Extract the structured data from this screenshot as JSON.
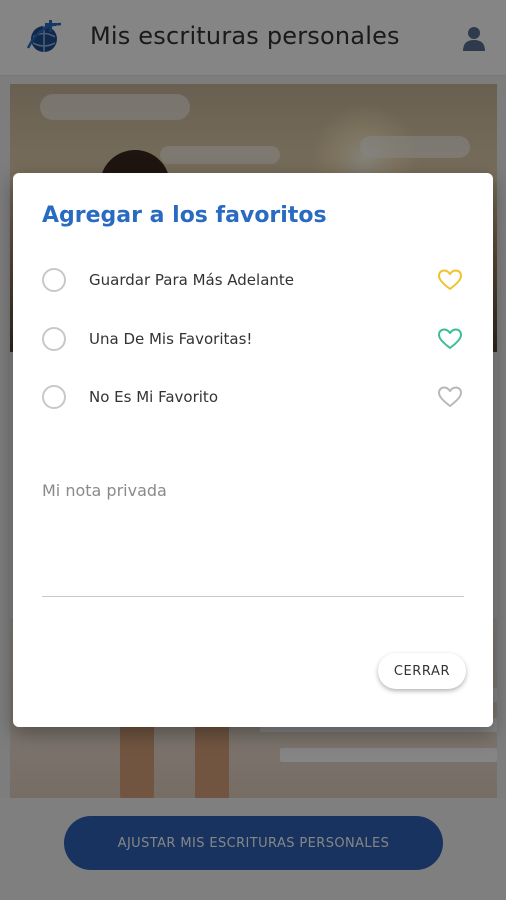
{
  "header": {
    "title": "Mis escrituras personales",
    "logo_icon": "globe-cross-icon",
    "user_icon": "user-icon"
  },
  "footer": {
    "adjust_button_label": "AJUSTAR MIS ESCRITURAS PERSONALES"
  },
  "dialog": {
    "title": "Agregar a los favoritos",
    "options": [
      {
        "label": "Guardar Para Más Adelante",
        "icon": "heart-icon",
        "color": "#f2c12e",
        "selected": false
      },
      {
        "label": "Una De Mis Favoritas!",
        "icon": "heart-icon",
        "color": "#3cbf8f",
        "selected": false
      },
      {
        "label": "No Es Mi Favorito",
        "icon": "heart-icon",
        "color": "#b8b8b8",
        "selected": false
      }
    ],
    "note_placeholder": "Mi nota privada",
    "close_label": "CERRAR"
  },
  "colors": {
    "accent": "#2a6bc2",
    "button_bg": "#2e63b8"
  }
}
